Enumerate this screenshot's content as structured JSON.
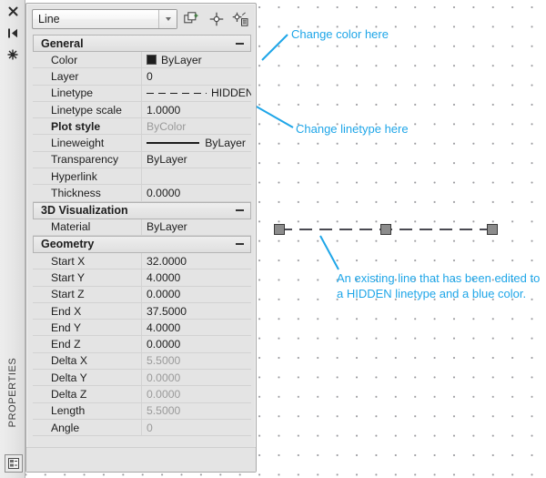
{
  "app": {
    "palette_title": "PROPERTIES",
    "side_icons": [
      {
        "name": "close-icon",
        "glyph": "✕"
      },
      {
        "name": "auto-hide-icon",
        "glyph": "▌◀"
      },
      {
        "name": "palette-properties-icon",
        "glyph": "✵"
      }
    ],
    "bottom_icon_name": "properties-panel-icon"
  },
  "toolbar": {
    "object_type": "Line",
    "dropdown_icon": "chevron-down-icon",
    "buttons": [
      {
        "name": "toggle-pickadd-button",
        "label": "Toggle value of PICKADD Sysvar"
      },
      {
        "name": "select-objects-button",
        "label": "Select Objects"
      },
      {
        "name": "quick-select-button",
        "label": "Quick Select"
      }
    ]
  },
  "sections": [
    {
      "id": "general",
      "title": "General",
      "collapse_icon": "minus-icon",
      "rows": [
        {
          "label": "Color",
          "value": "ByLayer",
          "swatch": "color",
          "readonly": false,
          "bold": false
        },
        {
          "label": "Layer",
          "value": "0",
          "swatch": "none",
          "readonly": false,
          "bold": false
        },
        {
          "label": "Linetype",
          "value": "HIDDEN",
          "swatch": "dashed",
          "readonly": false,
          "bold": false
        },
        {
          "label": "Linetype scale",
          "value": "1.0000",
          "swatch": "none",
          "readonly": false,
          "bold": false
        },
        {
          "label": "Plot style",
          "value": "ByColor",
          "swatch": "none",
          "readonly": true,
          "bold": true
        },
        {
          "label": "Lineweight",
          "value": "ByLayer",
          "swatch": "solid",
          "readonly": false,
          "bold": false
        },
        {
          "label": "Transparency",
          "value": "ByLayer",
          "swatch": "none",
          "readonly": false,
          "bold": false
        },
        {
          "label": "Hyperlink",
          "value": "",
          "swatch": "none",
          "readonly": false,
          "bold": false
        },
        {
          "label": "Thickness",
          "value": "0.0000",
          "swatch": "none",
          "readonly": false,
          "bold": false
        }
      ]
    },
    {
      "id": "visualization3d",
      "title": "3D Visualization",
      "collapse_icon": "minus-icon",
      "rows": [
        {
          "label": "Material",
          "value": "ByLayer",
          "swatch": "none",
          "readonly": false,
          "bold": false
        }
      ]
    },
    {
      "id": "geometry",
      "title": "Geometry",
      "collapse_icon": "minus-icon",
      "rows": [
        {
          "label": "Start X",
          "value": "32.0000",
          "swatch": "none",
          "readonly": false,
          "bold": false
        },
        {
          "label": "Start Y",
          "value": "4.0000",
          "swatch": "none",
          "readonly": false,
          "bold": false
        },
        {
          "label": "Start Z",
          "value": "0.0000",
          "swatch": "none",
          "readonly": false,
          "bold": false
        },
        {
          "label": "End X",
          "value": "37.5000",
          "swatch": "none",
          "readonly": false,
          "bold": false
        },
        {
          "label": "End Y",
          "value": "4.0000",
          "swatch": "none",
          "readonly": false,
          "bold": false
        },
        {
          "label": "End Z",
          "value": "0.0000",
          "swatch": "none",
          "readonly": false,
          "bold": false
        },
        {
          "label": "Delta X",
          "value": "5.5000",
          "swatch": "none",
          "readonly": true,
          "bold": false
        },
        {
          "label": "Delta Y",
          "value": "0.0000",
          "swatch": "none",
          "readonly": true,
          "bold": false
        },
        {
          "label": "Delta Z",
          "value": "0.0000",
          "swatch": "none",
          "readonly": true,
          "bold": false
        },
        {
          "label": "Length",
          "value": "5.5000",
          "swatch": "none",
          "readonly": true,
          "bold": false
        },
        {
          "label": "Angle",
          "value": "0",
          "swatch": "none",
          "readonly": true,
          "bold": false
        }
      ]
    }
  ],
  "annotations": {
    "accent_color": "#1fa6e8",
    "color_note": "Change color here",
    "linetype_note": "Change linetype here",
    "line_note": "An existing line that has been edited to\na HIDDEN linetype and a blue color."
  },
  "canvas": {
    "entity_name": "selected-line",
    "grips": 3,
    "grid": "dot-grid"
  }
}
